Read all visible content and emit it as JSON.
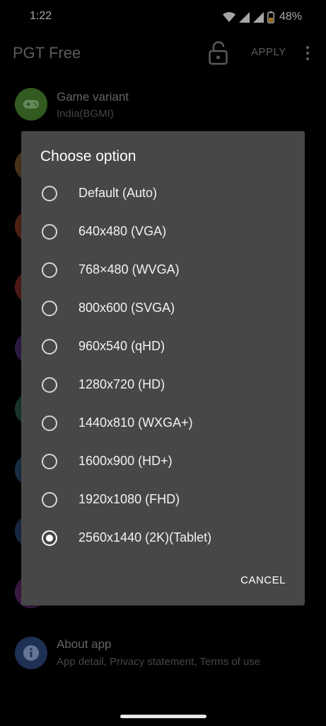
{
  "status_bar": {
    "time": "1:22",
    "battery": "48%",
    "icons": [
      "wifi-icon",
      "signal-icon",
      "signal-icon",
      "battery-icon"
    ]
  },
  "app_bar": {
    "title": "PGT Free",
    "apply_label": "APPLY",
    "icons": [
      "lock-open-icon",
      "more-vert-icon"
    ]
  },
  "list": {
    "items": [
      {
        "title": "Game variant",
        "subtitle": "India(BGMI)",
        "icon": "gamepad-icon",
        "color": "#5a9a3a"
      },
      {
        "title": "",
        "subtitle": "",
        "icon": "circle-icon",
        "color": "#b07a3a"
      },
      {
        "title": "",
        "subtitle": "",
        "icon": "circle-icon",
        "color": "#c0502e"
      },
      {
        "title": "",
        "subtitle": "",
        "icon": "circle-icon",
        "color": "#b83a3a"
      },
      {
        "title": "",
        "subtitle": "",
        "icon": "circle-icon",
        "color": "#6a3aa0"
      },
      {
        "title": "",
        "subtitle": "",
        "icon": "circle-icon",
        "color": "#3a7a6a"
      },
      {
        "title": "",
        "subtitle": "",
        "icon": "circle-icon",
        "color": "#3a6a9a"
      },
      {
        "title": "",
        "subtitle": "",
        "icon": "circle-icon",
        "color": "#3a5a9a"
      },
      {
        "title": "",
        "subtitle": "",
        "icon": "circle-icon",
        "color": "#8a3a9a"
      },
      {
        "title": "About app",
        "subtitle": "App detail, Privacy statement, Terms of use",
        "icon": "info-icon",
        "color": "#3a5a9a"
      }
    ]
  },
  "dialog": {
    "title": "Choose option",
    "options": [
      "Default (Auto)",
      "640x480 (VGA)",
      "768×480 (WVGA)",
      "800x600 (SVGA)",
      "960x540 (qHD)",
      "1280x720 (HD)",
      "1440x810 (WXGA+)",
      "1600x900 (HD+)",
      "1920x1080 (FHD)",
      "2560x1440 (2K)(Tablet)"
    ],
    "selected_index": 9,
    "cancel_label": "CANCEL"
  }
}
